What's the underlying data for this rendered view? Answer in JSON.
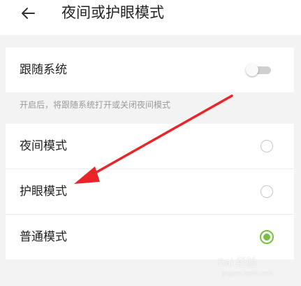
{
  "header": {
    "title": "夜间或护眼模式",
    "back_icon": "arrow-left-icon"
  },
  "follow_system": {
    "label": "跟随系统",
    "toggle_on": false
  },
  "hint": "开启后，将跟随系统打开或关闭夜间模式",
  "modes": [
    {
      "label": "夜间模式",
      "selected": false
    },
    {
      "label": "护眼模式",
      "selected": false
    },
    {
      "label": "普通模式",
      "selected": true
    }
  ],
  "colors": {
    "accent": "#76c043",
    "annotation_arrow": "#e8262a"
  },
  "watermark": {
    "text": "Bai 经验",
    "sub": "jingyan.baidu.com"
  }
}
